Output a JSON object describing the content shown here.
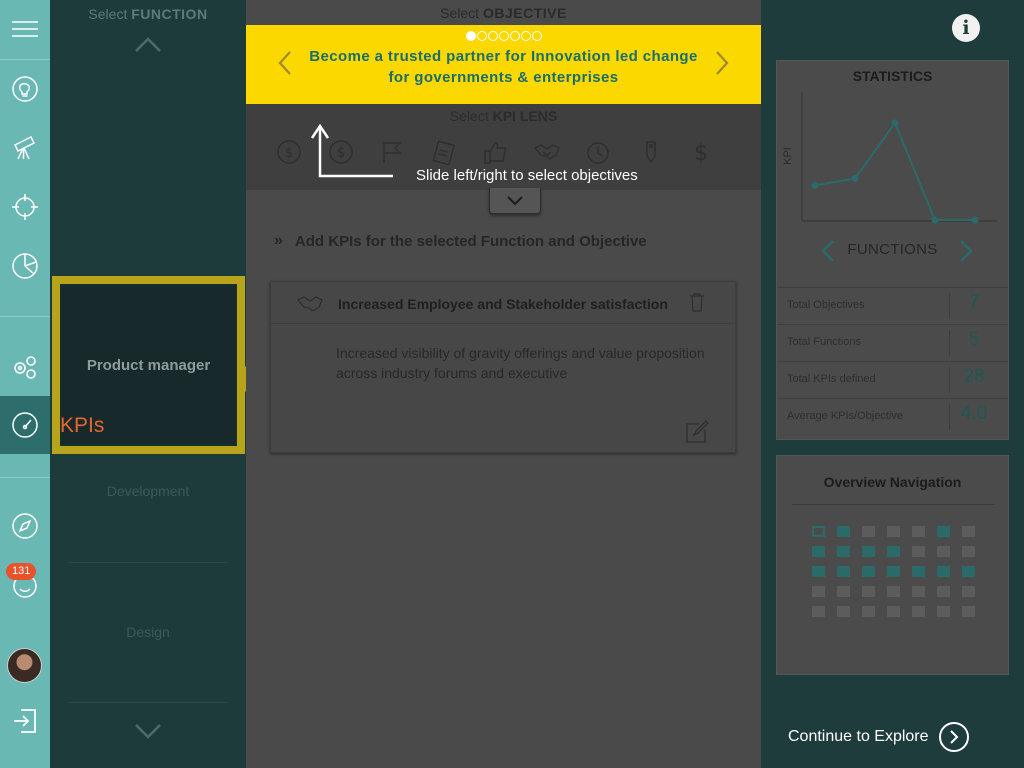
{
  "function_column": {
    "title_prefix": "Select ",
    "title_bold": "FUNCTION",
    "items": [
      "Development",
      "Design"
    ],
    "selected": "Product manager",
    "kpis_label": "KPIs"
  },
  "rail": {
    "notification_count": "131",
    "icons": [
      "menu-icon",
      "lightbulb-icon",
      "telescope-icon",
      "target-icon",
      "pie-chart-icon",
      "gears-icon",
      "speedometer-icon",
      "compass-icon",
      "smiley-icon",
      "avatar",
      "logout-icon"
    ]
  },
  "objective": {
    "title_prefix": "Select ",
    "title_bold": "OBJECTIVE",
    "text": "Become a trusted partner for Innovation led change for governments & enterprises",
    "dots_total": 7,
    "dots_active_index": 0
  },
  "kpi_lens": {
    "title_prefix": "Select ",
    "title_bold": "KPI LENS",
    "icons": [
      "dollar-cycle-icon",
      "dollar-circle-icon",
      "flag-icon",
      "clipboard-icon",
      "thumbs-up-icon",
      "handshake-icon",
      "stopwatch-icon",
      "price-tag-icon",
      "dollar-icon"
    ]
  },
  "hint": "Slide left/right to select objectives",
  "add_kpis_label": "Add KPIs for the selected Function and Objective",
  "kpi_card": {
    "title": "Increased Employee and Stakeholder satisfaction",
    "description": "Increased visibility of gravity offerings and value proposition across industry forums and executive"
  },
  "statistics": {
    "title": "STATISTICS",
    "chart_ylabel": "KPI",
    "functions_label": "FUNCTIONS",
    "rows": [
      {
        "label": "Total Objectives",
        "value": "7"
      },
      {
        "label": "Total Functions",
        "value": "5"
      },
      {
        "label": "Total KPIs defined",
        "value": "28"
      },
      {
        "label": "Average KPIs/Objective",
        "value": "4.0"
      }
    ]
  },
  "chart_data": {
    "type": "line",
    "ylabel": "KPI",
    "series": [
      {
        "values": [
          5,
          6,
          14,
          0,
          0
        ]
      }
    ]
  },
  "overview": {
    "title": "Overview Navigation",
    "rows": [
      [
        2,
        1,
        0,
        0,
        0,
        1,
        0
      ],
      [
        1,
        1,
        1,
        1,
        0,
        0,
        0
      ],
      [
        1,
        1,
        1,
        1,
        1,
        1,
        1
      ],
      [
        0,
        0,
        0,
        0,
        0,
        0,
        0
      ],
      [
        0,
        0,
        0,
        0,
        0,
        0,
        0
      ]
    ]
  },
  "continue_label": "Continue to Explore",
  "colors": {
    "accent_yellow": "#fbd800",
    "teal": "#6ab8b4",
    "kpi_orange": "#e8652f"
  }
}
